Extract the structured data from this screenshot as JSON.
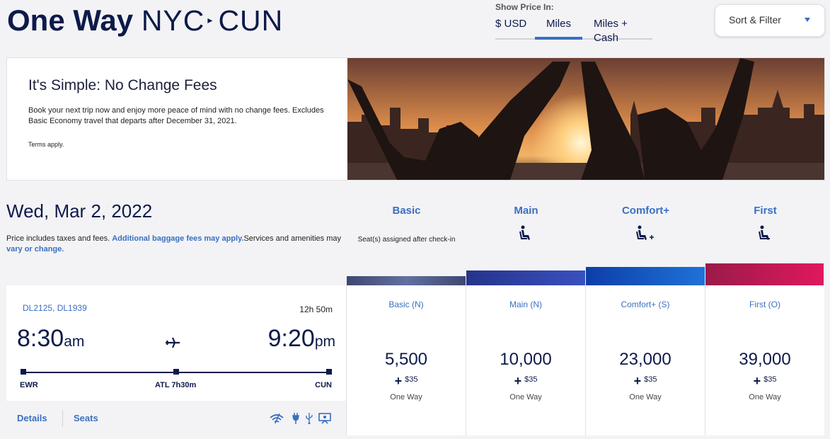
{
  "header": {
    "title_bold": "One Way",
    "origin": "NYC",
    "destination": "CUN",
    "show_price_label": "Show Price In:",
    "price_tabs": [
      "$ USD",
      "Miles",
      "Miles + Cash"
    ],
    "active_price_tab": "Miles",
    "sort_filter_label": "Sort & Filter"
  },
  "banner": {
    "heading": "It's Simple: No Change Fees",
    "body": "Book your next trip now and enjoy more peace of mind with no change fees. Excludes Basic Economy travel that departs after December 31, 2021.",
    "terms": "Terms apply."
  },
  "results": {
    "date": "Wed, Mar 2, 2022",
    "note_prefix": "Price includes taxes and fees. ",
    "note_link1": "Additional baggage fees may apply.",
    "note_middle": "Services and amenities may ",
    "note_link2": "vary or change.",
    "seat_note": "Seat(s) assigned after check-in",
    "columns": [
      "Basic",
      "Main",
      "Comfort+",
      "First"
    ]
  },
  "flight": {
    "numbers": "DL2125, DL1939",
    "duration": "12h 50m",
    "depart_time": "8:30",
    "depart_ampm": "am",
    "arrive_time": "9:20",
    "arrive_ampm": "pm",
    "origin": "EWR",
    "layover": "ATL 7h30m",
    "destination": "CUN",
    "details_label": "Details",
    "seats_label": "Seats"
  },
  "fares": [
    {
      "class": "Basic (N)",
      "miles": "5,500",
      "cash": "$35",
      "trip": "One Way"
    },
    {
      "class": "Main (N)",
      "miles": "10,000",
      "cash": "$35",
      "trip": "One Way"
    },
    {
      "class": "Comfort+ (S)",
      "miles": "23,000",
      "cash": "$35",
      "trip": "One Way"
    },
    {
      "class": "First (O)",
      "miles": "39,000",
      "cash": "$35",
      "trip": "One Way"
    }
  ],
  "colors": {
    "brand_navy": "#0d1a4a",
    "link_blue": "#3a6fc2",
    "basic_bar": "#4a5680",
    "main_bar": "#2a3c9a",
    "comfort_bar": "#1a5cc0",
    "first_bar": "#c01a5a"
  },
  "icons": {
    "route_arrow": "chevron-right-icon",
    "plane": "airplane-icon",
    "seat": "seat-icon",
    "amenities": [
      "wifi-icon",
      "power-outlet-icon",
      "usb-icon",
      "entertainment-screen-icon"
    ]
  }
}
